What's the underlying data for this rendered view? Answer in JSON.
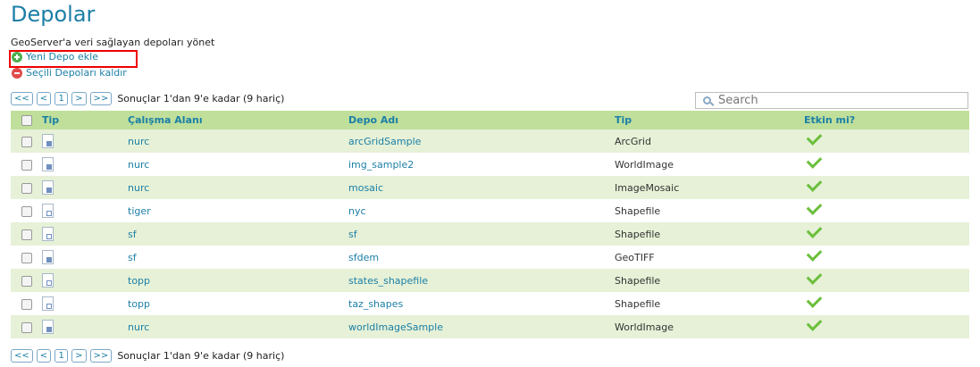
{
  "page": {
    "title": "Depolar",
    "description": "GeoServer'a veri sağlayan depoları yönet",
    "add_label": "Yeni Depo ekle",
    "remove_label": "Seçili Depoları kaldır"
  },
  "pager": {
    "first": "<<",
    "prev": "<",
    "page": "1",
    "next": ">",
    "last": ">>",
    "info": "Sonuçlar 1'dan 9'e kadar (9 hariç)"
  },
  "search": {
    "placeholder": "Search"
  },
  "table": {
    "headers": {
      "tip": "Tip",
      "workspace": "Çalışma Alanı",
      "name": "Depo Adı",
      "type": "Tip",
      "enabled": "Etkin mi?"
    },
    "rows": [
      {
        "icon": "raster",
        "workspace": "nurc",
        "name": "arcGridSample",
        "type": "ArcGrid",
        "enabled": true
      },
      {
        "icon": "raster",
        "workspace": "nurc",
        "name": "img_sample2",
        "type": "WorldImage",
        "enabled": true
      },
      {
        "icon": "raster",
        "workspace": "nurc",
        "name": "mosaic",
        "type": "ImageMosaic",
        "enabled": true
      },
      {
        "icon": "vector",
        "workspace": "tiger",
        "name": "nyc",
        "type": "Shapefile",
        "enabled": true
      },
      {
        "icon": "vector",
        "workspace": "sf",
        "name": "sf",
        "type": "Shapefile",
        "enabled": true
      },
      {
        "icon": "raster",
        "workspace": "sf",
        "name": "sfdem",
        "type": "GeoTIFF",
        "enabled": true
      },
      {
        "icon": "vector",
        "workspace": "topp",
        "name": "states_shapefile",
        "type": "Shapefile",
        "enabled": true
      },
      {
        "icon": "vector",
        "workspace": "topp",
        "name": "taz_shapes",
        "type": "Shapefile",
        "enabled": true
      },
      {
        "icon": "raster",
        "workspace": "nurc",
        "name": "worldImageSample",
        "type": "WorldImage",
        "enabled": true
      }
    ]
  },
  "colors": {
    "accent": "#1c7fa6",
    "header_bg": "#bfdf9b",
    "row_alt": "#e6f1d7",
    "highlight": "#e00000"
  }
}
